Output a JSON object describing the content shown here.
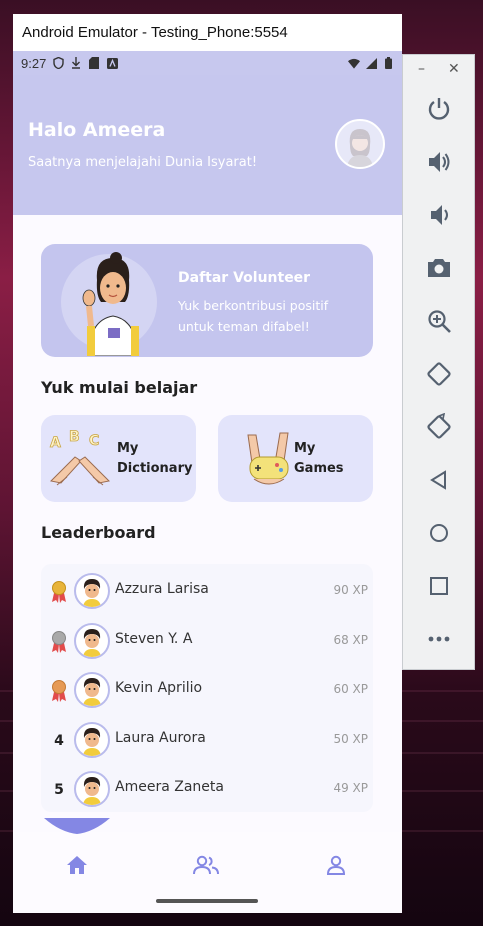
{
  "window": {
    "title": "Android Emulator - Testing_Phone:5554"
  },
  "status_bar": {
    "time": "9:27"
  },
  "header": {
    "greeting": "Halo Ameera",
    "subtitle": "Saatnya menjelajahi Dunia Isyarat!"
  },
  "volunteer": {
    "title": "Daftar Volunteer",
    "description": "Yuk berkontribusi positif untuk teman difabel!"
  },
  "learn": {
    "section_title": "Yuk mulai belajar",
    "dictionary_label_1": "My",
    "dictionary_label_2": "Dictionary",
    "games_label_1": "My",
    "games_label_2": "Games"
  },
  "leaderboard": {
    "section_title": "Leaderboard",
    "rows": [
      {
        "rank": "1",
        "name": "Azzura Larisa",
        "xp": "90 XP"
      },
      {
        "rank": "2",
        "name": "Steven Y. A",
        "xp": "68 XP"
      },
      {
        "rank": "3",
        "name": "Kevin Aprilio",
        "xp": "60 XP"
      },
      {
        "rank": "4",
        "name": "Laura Aurora",
        "xp": "50 XP"
      },
      {
        "rank": "5",
        "name": "Ameera Zaneta",
        "xp": "49 XP"
      }
    ]
  },
  "nav": {
    "items": [
      "home-icon",
      "community-icon",
      "profile-icon"
    ],
    "active": "home-icon"
  },
  "colors": {
    "accent": "#8487e4",
    "header_bg": "#c6c7ee",
    "card_bg": "#e3e4fb",
    "gold": "#e8b43a",
    "silver": "#a9a9a9",
    "bronze": "#e69a55"
  },
  "toolbar": {
    "buttons": [
      "minimize-icon",
      "close-icon",
      "power-icon",
      "volume-up-icon",
      "volume-down-icon",
      "camera-icon",
      "zoom-icon",
      "rotate-left-icon",
      "rotate-right-icon",
      "back-icon",
      "home-circle-icon",
      "overview-icon",
      "more-icon"
    ]
  }
}
